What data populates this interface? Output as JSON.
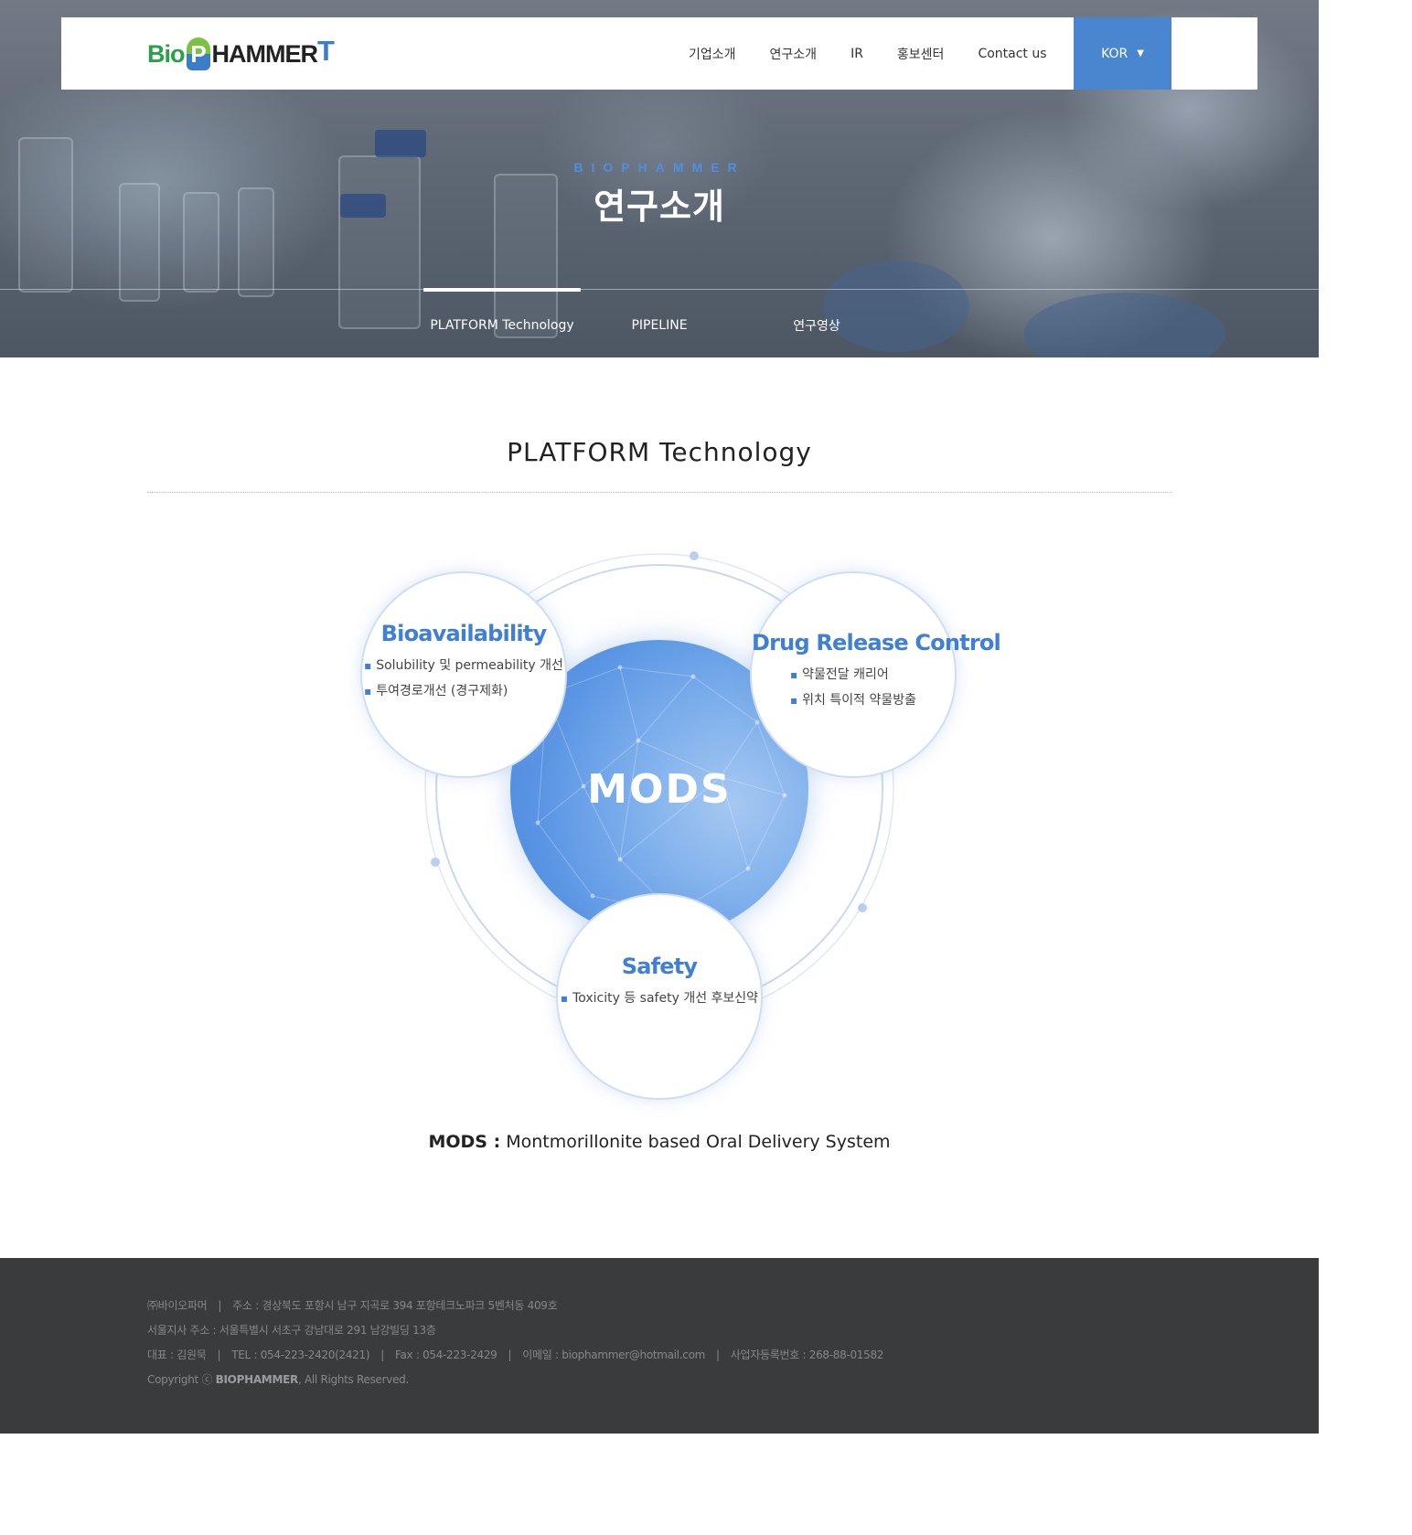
{
  "header": {
    "logo_text": "BioPHAMMERT",
    "logo_parts": {
      "bio": "Bio",
      "p": "P",
      "hammer": "HAMMER",
      "t": "T"
    },
    "nav": [
      "기업소개",
      "연구소개",
      "IR",
      "홍보센터",
      "Contact us"
    ],
    "lang": "KOR"
  },
  "hero": {
    "eyebrow": "BIOPHAMMER",
    "title": "연구소개",
    "tabs": [
      "PLATFORM Technology",
      "PIPELINE",
      "연구영상"
    ],
    "active_tab": 0
  },
  "main": {
    "section_title": "PLATFORM Technology",
    "center_label": "MODS",
    "circles": {
      "bioavailability": {
        "title": "Bioavailability",
        "items": [
          "Solubility 및 permeability 개선",
          "투여경로개선 (경구제화)"
        ]
      },
      "drug_release": {
        "title": "Drug Release Control",
        "items": [
          "약물전달 캐리어",
          "위치 특이적 약물방출"
        ]
      },
      "safety": {
        "title": "Safety",
        "items": [
          "Toxicity 등 safety 개선 후보신약"
        ]
      }
    },
    "caption_bold": "MODS :",
    "caption_text": " Montmorillonite based Oral Delivery System"
  },
  "footer": {
    "company": "㈜바이오파머",
    "address": "주소 : 경상북도 포항시 남구 지곡로 394 포항테크노파크 5벤처동 409호",
    "branch": "서울지사 주소 : 서울특별시 서초구 강남대로 291 남강빌딩 13층",
    "ceo": "대표 : 김원묵",
    "tel": "TEL : 054-223-2420(2421)",
    "fax": "Fax : 054-223-2429",
    "email": "이메일 : biophammer@hotmail.com",
    "biz_no": "사업자등록번호 : 268-88-01582",
    "copyright_prefix": "Copyright ⓒ ",
    "copyright_brand": "BIOPHAMMER",
    "copyright_suffix": ", All Rights Reserved."
  },
  "colors": {
    "accent": "#4a86d0",
    "circle_title": "#3f7fd6",
    "footer_bg": "#3a3b3d",
    "logo_green": "#2aa148"
  }
}
